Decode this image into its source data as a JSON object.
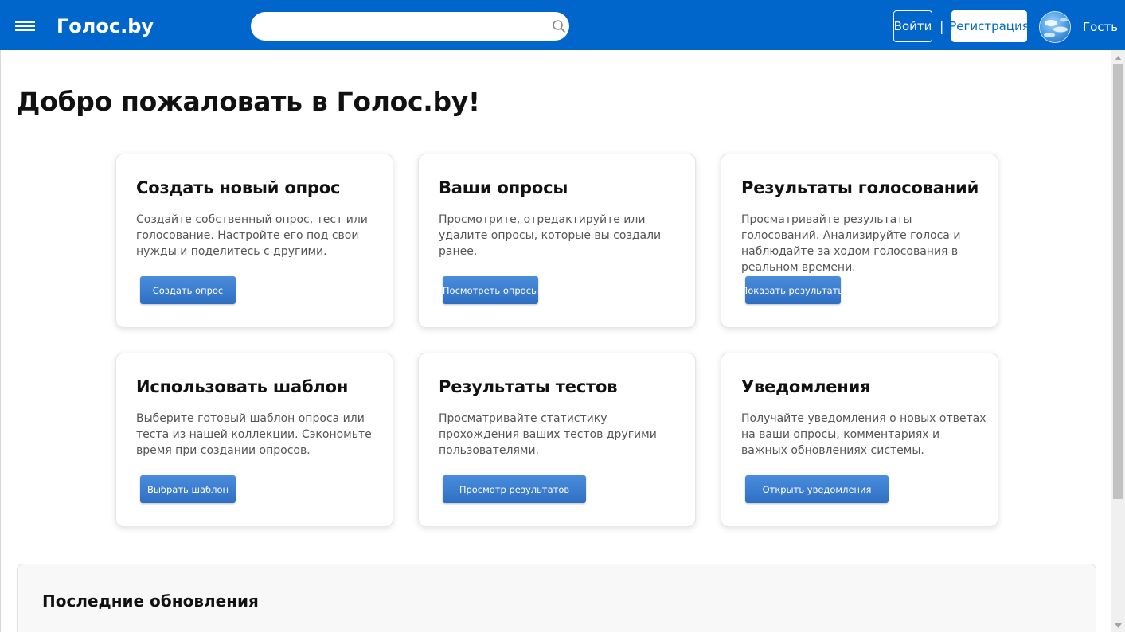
{
  "header": {
    "logo": "Голос.by",
    "search_placeholder": "",
    "login_label": "Войти",
    "separator": "|",
    "register_label": "Регистрация",
    "user_label": "Гость"
  },
  "main": {
    "welcome_title": "Добро пожаловать в Голос.by!",
    "cards": [
      {
        "title": "Создать новый опрос",
        "description": "Создайте собственный опрос, тест или голосование. Настройте его под свои нужды и поделитесь с другими.",
        "button": "Создать опрос"
      },
      {
        "title": "Ваши опросы",
        "description": "Просмотрите, отредактируйте или удалите опросы, которые вы создали ранее.",
        "button": "Посмотреть опросы"
      },
      {
        "title": "Результаты голосований",
        "description": "Просматривайте результаты голосований. Анализируйте голоса и наблюдайте за ходом голосования в реальном времени.",
        "button": "Показать результаты"
      },
      {
        "title": "Использовать шаблон",
        "description": "Выберите готовый шаблон опроса или теста из нашей коллекции. Сэкономьте время при создании опросов.",
        "button": "Выбрать шаблон"
      },
      {
        "title": "Результаты тестов",
        "description": "Просматривайте статистику прохождения ваших тестов другими пользователями.",
        "button": "Просмотр результатов"
      },
      {
        "title": "Уведомления",
        "description": "Получайте уведомления о новых ответах на ваши опросы, комментариях и важных обновлениях системы.",
        "button": "Открыть уведомления"
      }
    ],
    "updates_title": "Последние обновления"
  },
  "colors": {
    "header_bg": "#0066cc",
    "button_bg": "#3a7bd0",
    "register_text": "#0066cc"
  },
  "icons": [
    "hamburger-icon",
    "search-icon",
    "avatar-globe-icon"
  ]
}
